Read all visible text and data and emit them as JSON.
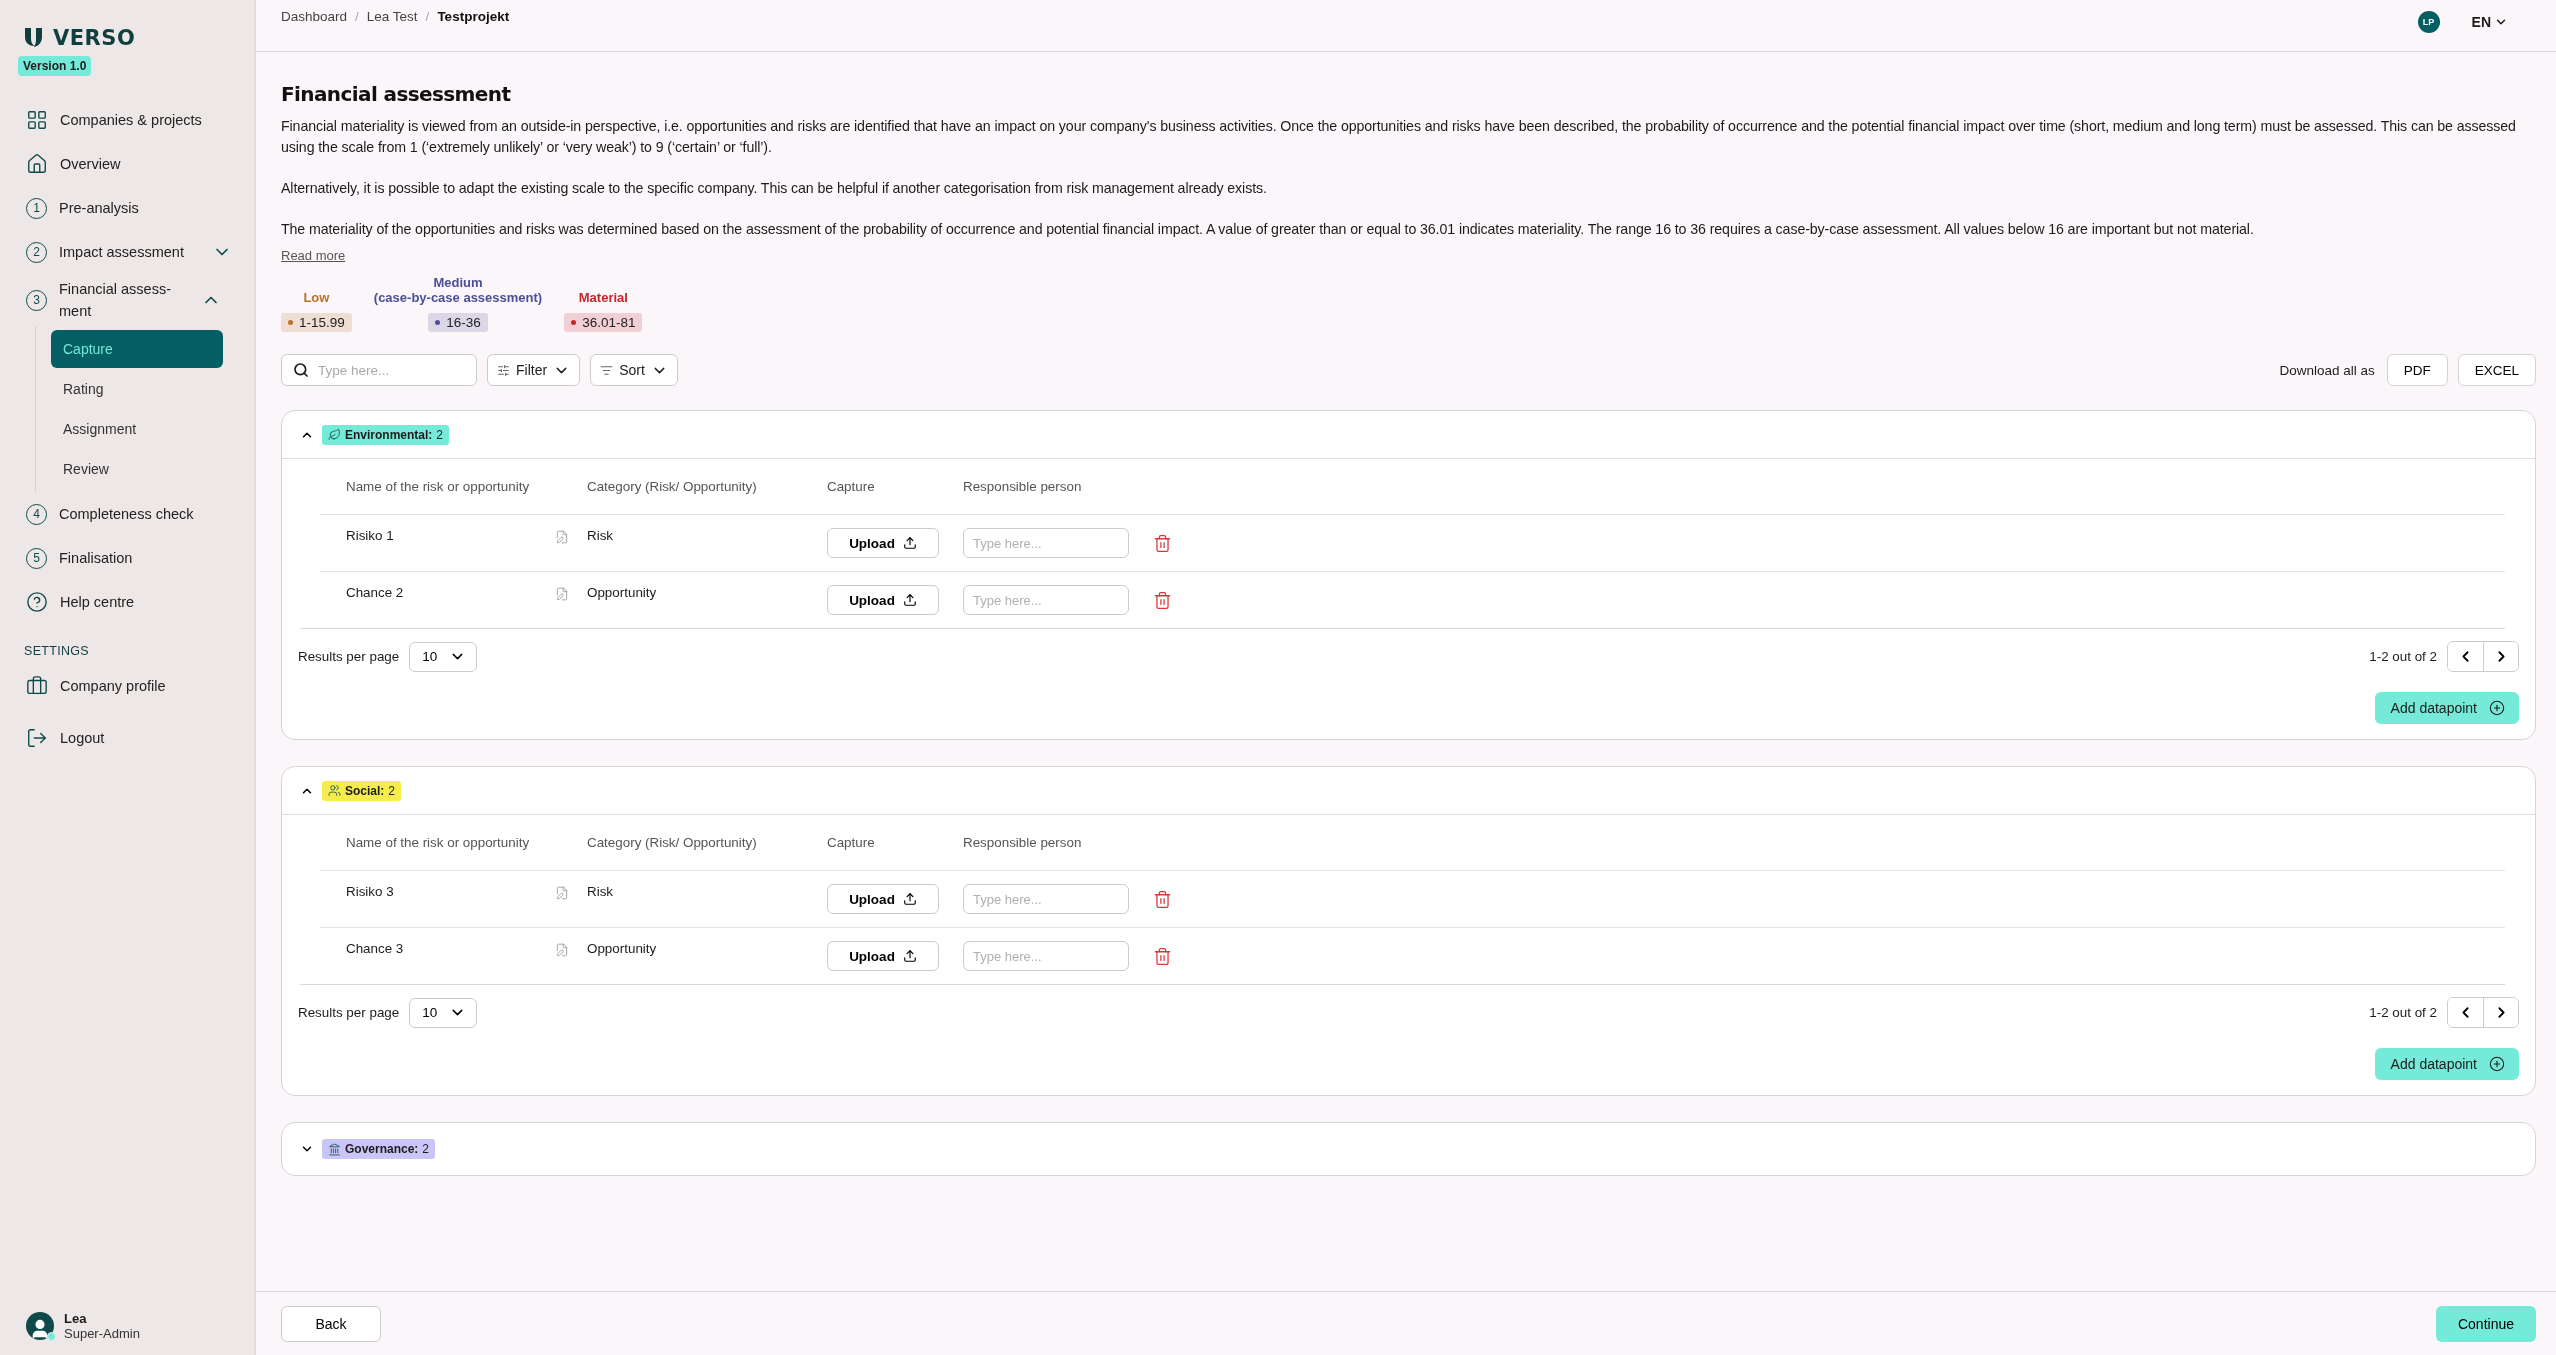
{
  "sidebar": {
    "logo": "VERSO",
    "version": "Version 1.0",
    "items": [
      {
        "label": "Companies & projects"
      },
      {
        "label": "Overview"
      },
      {
        "label": "Pre-analysis",
        "step": "1"
      },
      {
        "label": "Impact assessment",
        "step": "2",
        "expanded": false
      },
      {
        "label": "Financial assess-ment",
        "step": "3",
        "expanded": true,
        "children": [
          {
            "label": "Capture",
            "selected": true
          },
          {
            "label": "Rating",
            "selected": false
          },
          {
            "label": "Assignment",
            "selected": false
          },
          {
            "label": "Review",
            "selected": false
          }
        ]
      },
      {
        "label": "Completeness check",
        "step": "4"
      },
      {
        "label": "Finalisation",
        "step": "5"
      },
      {
        "label": "Help centre"
      }
    ],
    "settings_heading": "SETTINGS",
    "settings_items": [
      {
        "label": "Company profile"
      },
      {
        "label": "Logout"
      }
    ],
    "user": {
      "name": "Lea",
      "role": "Super-Admin",
      "online": true
    }
  },
  "header": {
    "separator": "/",
    "breadcrumbs": [
      "Dashboard",
      "Lea Test",
      "Testprojekt"
    ],
    "avatar": "LP",
    "language": "EN"
  },
  "page": {
    "title": "Financial assessment",
    "paragraphs": [
      "Financial materiality is viewed from an outside-in perspective, i.e. opportunities and risks are identified that have an impact on your company's business activities. Once the opportunities and risks have been described, the probability of occurrence and the potential financial impact over time (short, medium and long term) must be assessed. This can be assessed using the scale from 1 (‘extremely unlikely’ or ‘very weak’) to 9 (‘certain’ or ‘full’).",
      "Alternatively, it is possible to adapt the existing scale to the specific company. This can be helpful if another categorisation from risk management already exists.",
      "The materiality of the opportunities and risks was determined based on the assessment of the probability of occurrence and potential financial impact. A value of greater than or equal to 36.01 indicates materiality. The range 16 to 36 requires a case-by-case assessment. All values below 16 are important but not material."
    ],
    "read_more": "Read more",
    "legend": [
      {
        "label": "Low",
        "range": "1-15.99",
        "color": "#b8732a"
      },
      {
        "label": "Medium\n(case-by-case assessment)",
        "range": "16-36",
        "color": "#4c4f96"
      },
      {
        "label": "Material",
        "range": "36.01-81",
        "color": "#c4252a"
      }
    ],
    "search_placeholder": "Type here...",
    "filter": "Filter",
    "sort": "Sort",
    "download_label": "Download all as",
    "downloads": [
      "PDF",
      "EXCEL"
    ]
  },
  "groups": [
    {
      "label": "Environmental:",
      "count": "2",
      "color": "#76ead9",
      "expanded": true,
      "columns": [
        "Name of the risk or opportunity",
        "Category (Risk/ Opportunity)",
        "Capture",
        "Responsible person"
      ],
      "rows": [
        {
          "name": "Risiko 1",
          "category": "Risk",
          "upload": "Upload",
          "placeholder": "Type here..."
        },
        {
          "name": "Chance 2",
          "category": "Opportunity",
          "upload": "Upload",
          "placeholder": "Type here..."
        }
      ],
      "per_page_label": "Results per page",
      "per_page": "10",
      "range": "1-2 out of 2",
      "add": "Add datapoint"
    },
    {
      "label": "Social:",
      "count": "2",
      "color": "#f7ec4e",
      "expanded": true,
      "columns": [
        "Name of the risk or opportunity",
        "Category (Risk/ Opportunity)",
        "Capture",
        "Responsible person"
      ],
      "rows": [
        {
          "name": "Risiko 3",
          "category": "Risk",
          "upload": "Upload",
          "placeholder": "Type here..."
        },
        {
          "name": "Chance 3",
          "category": "Opportunity",
          "upload": "Upload",
          "placeholder": "Type here..."
        }
      ],
      "per_page_label": "Results per page",
      "per_page": "10",
      "range": "1-2 out of 2",
      "add": "Add datapoint"
    },
    {
      "label": "Governance:",
      "count": "2",
      "color": "#c9c5f7",
      "expanded": false
    }
  ],
  "footer": {
    "back": "Back",
    "continue": "Continue"
  }
}
